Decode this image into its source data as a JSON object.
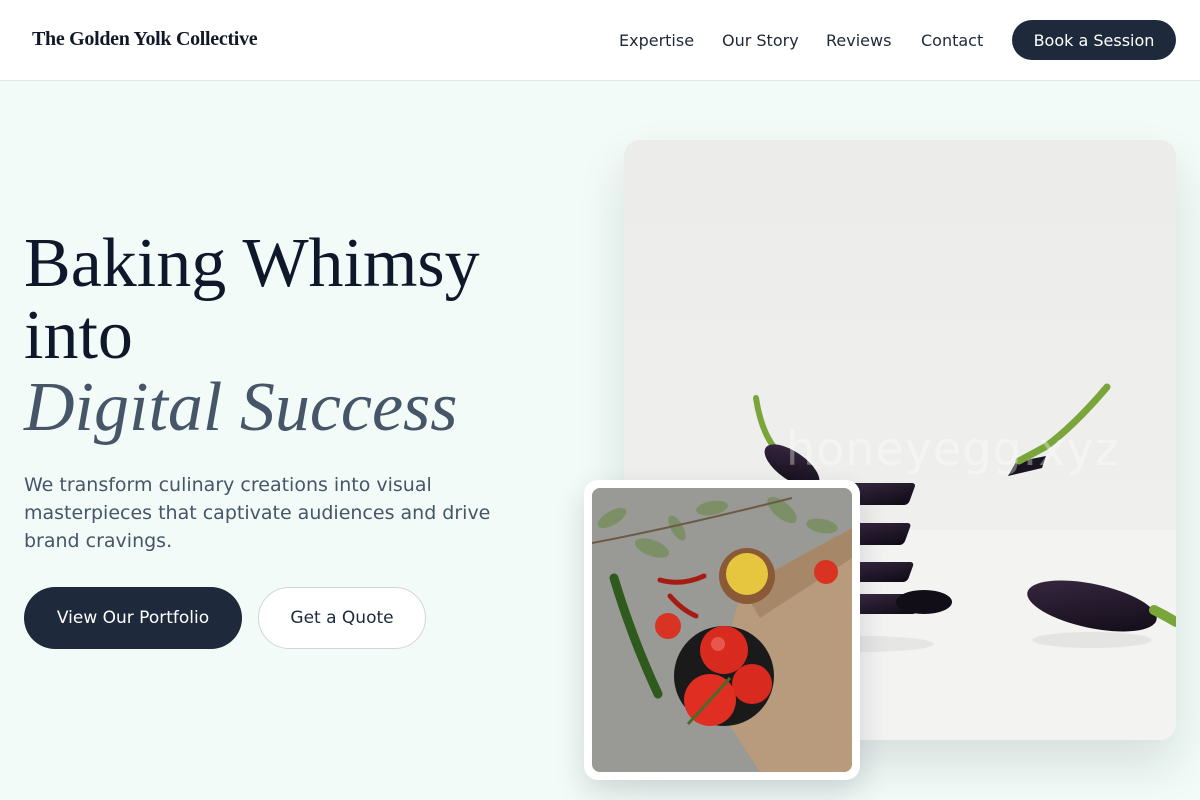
{
  "brand": {
    "name": "The Golden Yolk Collective"
  },
  "nav": {
    "items": [
      {
        "label": "Expertise"
      },
      {
        "label": "Our Story"
      },
      {
        "label": "Reviews"
      },
      {
        "label": "Contact"
      }
    ],
    "cta_label": "Book a Session"
  },
  "hero": {
    "title_line1": "Baking Whimsy",
    "title_line2": "into",
    "title_line3": "Digital Success",
    "subtitle": "We transform culinary creations into visual masterpieces that captivate audiences and drive brand cravings.",
    "primary_button": "View Our Portfolio",
    "secondary_button": "Get a Quote"
  },
  "images": {
    "main": {
      "subject": "sliced eggplants",
      "watermark": "honeyegg.xyz"
    },
    "secondary": {
      "subject": "tomatoes, chili peppers and herbs"
    }
  },
  "colors": {
    "accent": "#1e293b",
    "background": "#f2fbf7",
    "heading": "#0f172a",
    "muted": "#475569"
  }
}
